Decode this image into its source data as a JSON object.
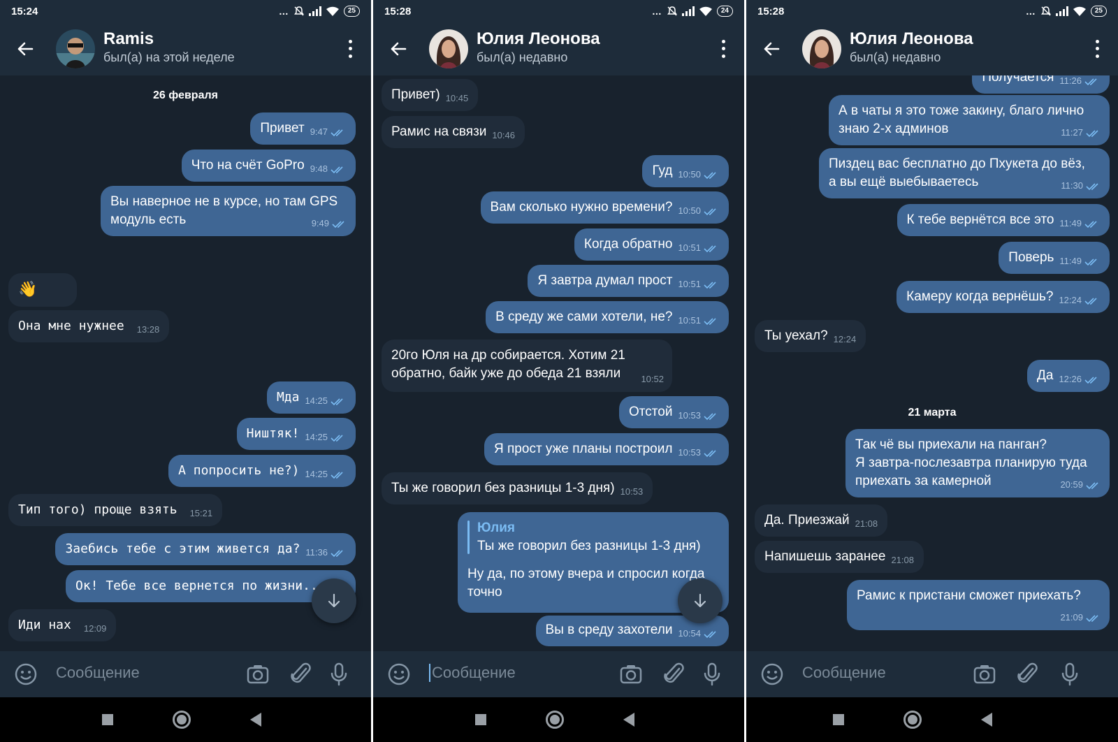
{
  "screens": [
    {
      "status": {
        "time": "15:24",
        "battery": "25"
      },
      "header": {
        "name": "Ramis",
        "status": "был(а) на этой неделе"
      },
      "date_separator": "26 февраля",
      "messages": [
        {
          "text": "Привет",
          "time": "9:47",
          "dir": "out"
        },
        {
          "text": "Что на счёт GoPro",
          "time": "9:48",
          "dir": "out"
        },
        {
          "text": "Вы наверное не в курсе, но там GPS\nмодуль есть",
          "time": "9:49",
          "dir": "out"
        },
        {
          "text": "👋",
          "time": "",
          "dir": "in"
        },
        {
          "text": "Она мне нужнее",
          "time": "13:28",
          "dir": "in"
        },
        {
          "text": "Мда",
          "time": "14:25",
          "dir": "out"
        },
        {
          "text": "Ништяк!",
          "time": "14:25",
          "dir": "out"
        },
        {
          "text": "А попросить не?)",
          "time": "14:25",
          "dir": "out"
        },
        {
          "text": "Тип того) проще взять",
          "time": "15:21",
          "dir": "in"
        },
        {
          "text": "Заебись тебе с этим живется да?",
          "time": "11:36",
          "dir": "out"
        },
        {
          "text": "Ок! Тебе все вернется по жизни...",
          "time": "",
          "dir": "out"
        },
        {
          "text": "Иди нах",
          "time": "12:09",
          "dir": "in"
        }
      ],
      "composer": {
        "placeholder": "Сообщение"
      }
    },
    {
      "status": {
        "time": "15:28",
        "battery": "24"
      },
      "header": {
        "name": "Юлия Леонова",
        "status": "был(а) недавно"
      },
      "messages": [
        {
          "text": "Привет)",
          "time": "10:45",
          "dir": "in"
        },
        {
          "text": "Рамис на связи",
          "time": "10:46",
          "dir": "in"
        },
        {
          "text": "Гуд",
          "time": "10:50",
          "dir": "out"
        },
        {
          "text": "Вам сколько нужно времени?",
          "time": "10:50",
          "dir": "out"
        },
        {
          "text": "Когда обратно",
          "time": "10:51",
          "dir": "out"
        },
        {
          "text": "Я завтра думал прост",
          "time": "10:51",
          "dir": "out"
        },
        {
          "text": "В среду же сами хотели, не?",
          "time": "10:51",
          "dir": "out"
        },
        {
          "text": "20го Юля на др собирается. Хотим 21\nобратно, байк уже до обеда 21 взяли",
          "time": "10:52",
          "dir": "in"
        },
        {
          "text": "Отстой",
          "time": "10:53",
          "dir": "out"
        },
        {
          "text": "Я прост уже планы построил",
          "time": "10:53",
          "dir": "out"
        },
        {
          "text": "Ты же говорил без разницы 1-3 дня)",
          "time": "10:53",
          "dir": "in"
        },
        {
          "reply_name": "Юлия",
          "reply_text": "Ты же говорил без разницы 1-3 дня)",
          "text": "Ну да, по этому вчера и спросил когда\nточно",
          "time": "",
          "dir": "out"
        },
        {
          "text": "Вы в среду захотели",
          "time": "10:54",
          "dir": "out"
        }
      ],
      "composer": {
        "placeholder": "Сообщение"
      }
    },
    {
      "status": {
        "time": "15:28",
        "battery": "25"
      },
      "header": {
        "name": "Юлия Леонова",
        "status": "был(а) недавно"
      },
      "date_separator": "21 марта",
      "messages": [
        {
          "text": "Получается",
          "time": "11:26",
          "dir": "out"
        },
        {
          "text": "А в чаты я это тоже закину, благо лично\nзнаю 2-х админов",
          "time": "11:27",
          "dir": "out"
        },
        {
          "text": "Пиздец вас бесплатно до Пхукета до вёз,\nа вы ещё выебываетесь",
          "time": "11:30",
          "dir": "out"
        },
        {
          "text": "К тебе вернётся все это",
          "time": "11:49",
          "dir": "out"
        },
        {
          "text": "Поверь",
          "time": "11:49",
          "dir": "out"
        },
        {
          "text": "Камеру когда вернёшь?",
          "time": "12:24",
          "dir": "out"
        },
        {
          "text": "Ты уехал?",
          "time": "12:24",
          "dir": "in"
        },
        {
          "text": "Да",
          "time": "12:26",
          "dir": "out"
        },
        {
          "text": "Так чё вы приехали на панган?\nЯ завтра-послезавтра планирую туда\nприехать за камерной",
          "time": "20:59",
          "dir": "out"
        },
        {
          "text": "Да. Приезжай",
          "time": "21:08",
          "dir": "in"
        },
        {
          "text": "Напишешь заранее",
          "time": "21:08",
          "dir": "in"
        },
        {
          "text": "Рамис к пристани сможет приехать?",
          "time": "21:09",
          "dir": "out"
        }
      ],
      "composer": {
        "placeholder": "Сообщение"
      }
    }
  ],
  "colors": {
    "background": "#18222d",
    "header": "#1e2c3a",
    "outgoing": "#3f6694",
    "incoming": "#202c3a",
    "accent": "#7bbcf3"
  },
  "icons": [
    "back-arrow-icon",
    "more-vertical-icon",
    "emoji-icon",
    "camera-icon",
    "attach-icon",
    "microphone-icon",
    "double-check-icon",
    "scroll-down-icon",
    "nav-recents-icon",
    "nav-home-icon",
    "nav-back-icon"
  ]
}
